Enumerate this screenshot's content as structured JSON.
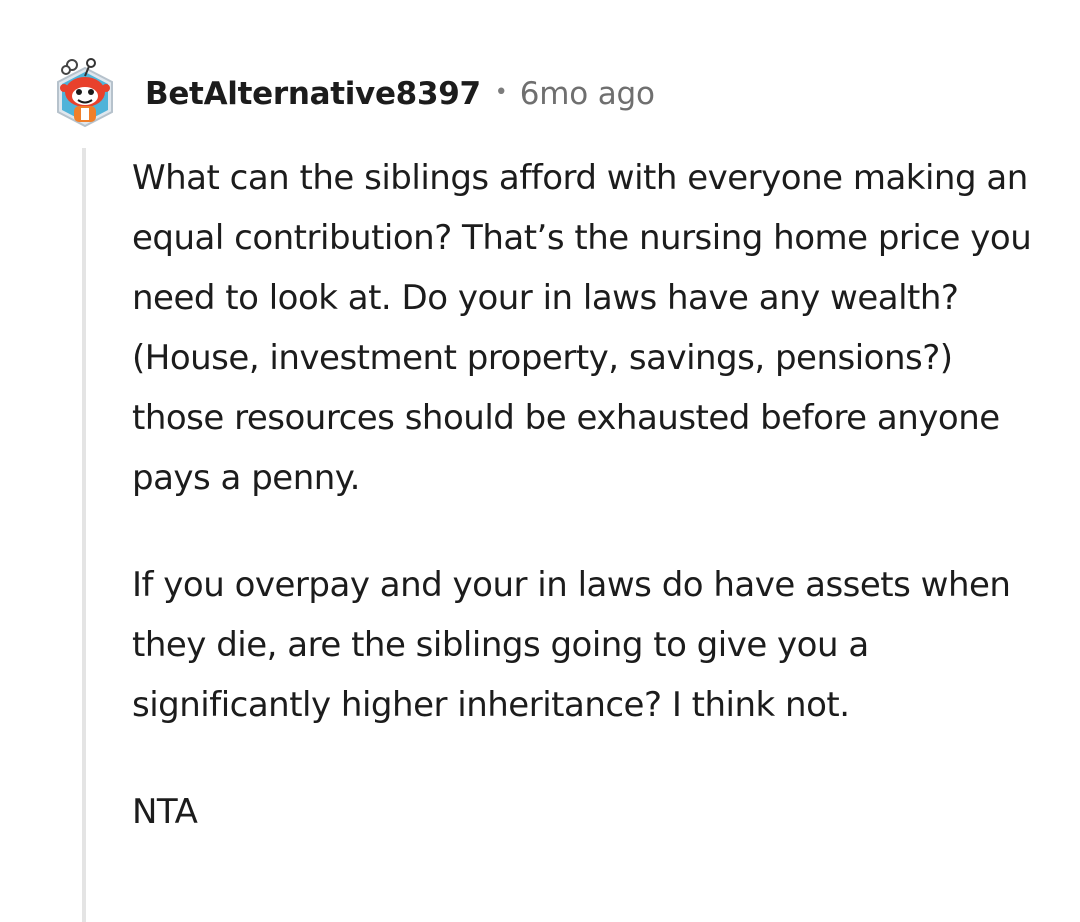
{
  "comment": {
    "author": "BetAlternative8397",
    "separator": "•",
    "timestamp": "6mo ago",
    "avatar_icon": "reddit-snoo-avatar-icon",
    "paragraphs": [
      "What can the siblings afford with everyone making an equal contribution? That’s the nursing home price you need to look at. Do your in laws have any wealth? (House, investment property, savings, pensions?) those resources should be exhausted before anyone pays a penny.",
      "If you overpay and your in laws do have assets when they die, are the siblings going to give you a significantly higher inheritance? I think not.",
      "NTA"
    ]
  },
  "colors": {
    "text": "#1c1c1c",
    "meta": "#6f6f6f",
    "thread_line": "#e4e4e4",
    "avatar_bg": "#4fb3d9",
    "avatar_snoo": "#e8412c"
  }
}
